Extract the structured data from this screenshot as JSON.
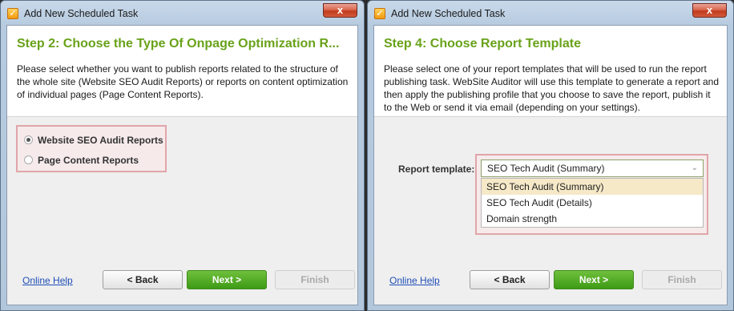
{
  "left_window": {
    "title": "Add New Scheduled Task",
    "app_icon": "checkmark-app-icon",
    "close_glyph": "x",
    "step_title": "Step 2: Choose the Type Of Onpage Optimization R...",
    "description": "Please select whether you want to publish reports related to the structure of the whole site (Website SEO Audit Reports) or reports on content optimization of individual pages (Page Content Reports).",
    "options": [
      {
        "label": "Website SEO Audit Reports",
        "selected": true
      },
      {
        "label": "Page Content Reports",
        "selected": false
      }
    ],
    "online_help": "Online Help",
    "back_label": "< Back",
    "next_label": "Next >",
    "finish_label": "Finish"
  },
  "right_window": {
    "title": "Add New Scheduled Task",
    "app_icon": "checkmark-app-icon",
    "close_glyph": "x",
    "step_title": "Step 4: Choose Report Template",
    "description": "Please select one of your report templates that will be used to run the report publishing task. WebSite Auditor will use this template to generate a report and then apply the publishing profile that you choose to save the report, publish it to the Web or send it via email (depending on your settings).",
    "template_label": "Report template:",
    "selected_template": "SEO Tech Audit (Summary)",
    "template_options": [
      "SEO Tech Audit (Summary)",
      "SEO Tech Audit (Details)",
      "Domain strength"
    ],
    "online_help": "Online Help",
    "back_label": "< Back",
    "next_label": "Next >",
    "finish_label": "Finish"
  },
  "colors": {
    "step_title": "#69a21a",
    "next_button": "#4aa51f",
    "highlight_border": "#e0a5a9",
    "link": "#1f4eb6"
  }
}
